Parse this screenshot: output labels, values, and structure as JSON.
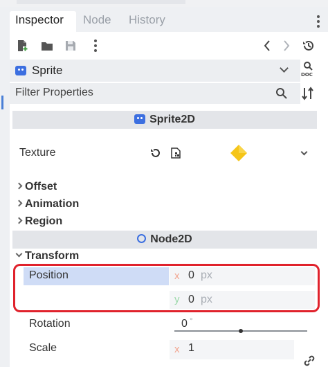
{
  "tabs": [
    {
      "label": "Inspector"
    },
    {
      "label": "Node"
    },
    {
      "label": "History"
    }
  ],
  "toolbar": {
    "icons": [
      "new-resource-icon",
      "open-folder-icon",
      "save-icon",
      "more-icon",
      "back-icon",
      "forward-icon",
      "history-icon"
    ]
  },
  "object_selector": {
    "label": "Sprite"
  },
  "filter": {
    "placeholder": "Filter Properties"
  },
  "sprite2d": {
    "header": "Sprite2D",
    "texture_label": "Texture",
    "sections": {
      "offset": "Offset",
      "animation": "Animation",
      "region": "Region"
    }
  },
  "node2d": {
    "header": "Node2D",
    "transform_label": "Transform",
    "position": {
      "label": "Position",
      "x_axis": "x",
      "x_value": "0",
      "y_axis": "y",
      "y_value": "0",
      "unit": "px"
    },
    "rotation": {
      "label": "Rotation",
      "value": "0",
      "unit": "°",
      "slider_fraction": 0.5
    },
    "scale": {
      "label": "Scale",
      "x_axis": "x",
      "x_value": "1"
    }
  },
  "colors": {
    "accent": "#4a7fd6",
    "highlight_box": "#e0222c",
    "position_selected": "#cfdcf6",
    "node_icon": "#3c6fe0",
    "texture_icon": "#f5c518"
  }
}
